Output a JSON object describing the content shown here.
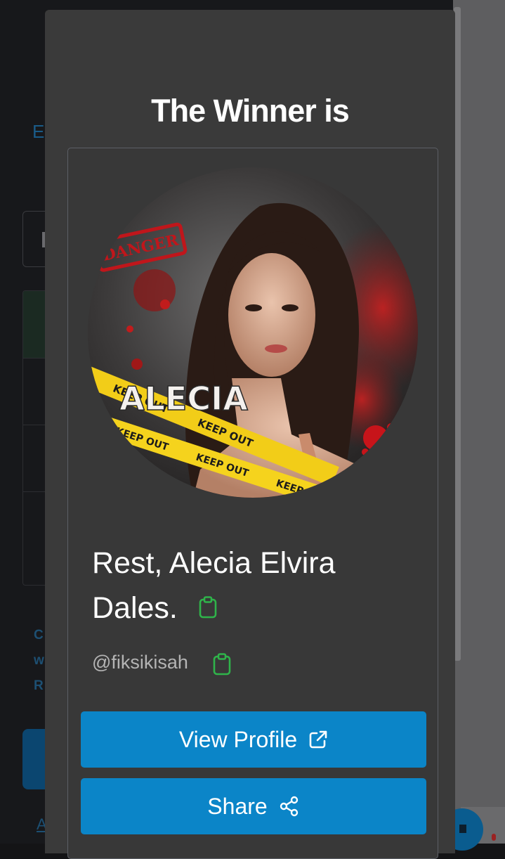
{
  "modal": {
    "title": "The Winner is",
    "winner": {
      "name": "Rest, Alecia Elvira Dales.",
      "handle": "@fiksikisah",
      "avatar_text": {
        "stamp": "DANGER",
        "name": "ALECIA",
        "tape": "KEEP OUT"
      }
    },
    "buttons": {
      "view_profile": "View Profile",
      "share": "Share"
    }
  },
  "background": {
    "link_fragment": "E",
    "text_fragments": [
      "C",
      "w",
      "R"
    ],
    "bottom_link_fragment": "A"
  },
  "icons": {
    "copy_name": "clipboard-icon",
    "copy_handle": "clipboard-icon",
    "view_profile": "external-link-icon",
    "share": "share-icon"
  },
  "colors": {
    "modal_bg": "#3a3a3a",
    "button_bg": "#0b85c8",
    "clipboard_green": "#2fb34a",
    "page_bg": "#17181b"
  }
}
